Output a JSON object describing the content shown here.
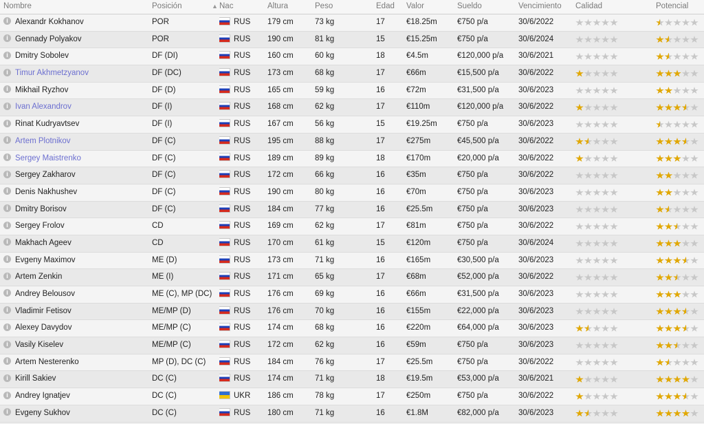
{
  "headers": {
    "nombre": "Nombre",
    "posicion": "Posición",
    "nac": "Nac",
    "altura": "Altura",
    "peso": "Peso",
    "edad": "Edad",
    "valor": "Valor",
    "sueldo": "Sueldo",
    "vencimiento": "Vencimiento",
    "calidad": "Calidad",
    "potencial": "Potencial"
  },
  "colors": {
    "link": "#6c6fd0",
    "star_filled": "#e2a800",
    "star_empty": "#c7c7c7"
  },
  "players": [
    {
      "name": "Alexandr Kokhanov",
      "link": false,
      "pos": "POR",
      "nat": "RUS",
      "alt": "179 cm",
      "peso": "73 kg",
      "edad": "17",
      "valor": "€18.25m",
      "sueldo": "€750 p/a",
      "venc": "30/6/2022",
      "cal": 0,
      "pot": 0.5
    },
    {
      "name": "Gennady Polyakov",
      "link": false,
      "pos": "POR",
      "nat": "RUS",
      "alt": "190 cm",
      "peso": "81 kg",
      "edad": "15",
      "valor": "€15.25m",
      "sueldo": "€750 p/a",
      "venc": "30/6/2024",
      "cal": 0,
      "pot": 1.5
    },
    {
      "name": "Dmitry Sobolev",
      "link": false,
      "pos": "DF (DI)",
      "nat": "RUS",
      "alt": "160 cm",
      "peso": "60 kg",
      "edad": "18",
      "valor": "€4.5m",
      "sueldo": "€120,000 p/a",
      "venc": "30/6/2021",
      "cal": 0,
      "pot": 1.5
    },
    {
      "name": "Timur Akhmetzyanov",
      "link": true,
      "pos": "DF (DC)",
      "nat": "RUS",
      "alt": "173 cm",
      "peso": "68 kg",
      "edad": "17",
      "valor": "€66m",
      "sueldo": "€15,500 p/a",
      "venc": "30/6/2022",
      "cal": 1,
      "pot": 3
    },
    {
      "name": "Mikhail Ryzhov",
      "link": false,
      "pos": "DF (D)",
      "nat": "RUS",
      "alt": "165 cm",
      "peso": "59 kg",
      "edad": "16",
      "valor": "€72m",
      "sueldo": "€31,500 p/a",
      "venc": "30/6/2023",
      "cal": 0,
      "pot": 2
    },
    {
      "name": "Ivan Alexandrov",
      "link": true,
      "pos": "DF (I)",
      "nat": "RUS",
      "alt": "168 cm",
      "peso": "62 kg",
      "edad": "17",
      "valor": "€110m",
      "sueldo": "€120,000 p/a",
      "venc": "30/6/2022",
      "cal": 1,
      "pot": 3.5
    },
    {
      "name": "Rinat Kudryavtsev",
      "link": false,
      "pos": "DF (I)",
      "nat": "RUS",
      "alt": "167 cm",
      "peso": "56 kg",
      "edad": "15",
      "valor": "€19.25m",
      "sueldo": "€750 p/a",
      "venc": "30/6/2023",
      "cal": 0,
      "pot": 0.5
    },
    {
      "name": "Artem Plotnikov",
      "link": true,
      "pos": "DF (C)",
      "nat": "RUS",
      "alt": "195 cm",
      "peso": "88 kg",
      "edad": "17",
      "valor": "€275m",
      "sueldo": "€45,500 p/a",
      "venc": "30/6/2022",
      "cal": 1.5,
      "pot": 3.5
    },
    {
      "name": "Sergey Maistrenko",
      "link": true,
      "pos": "DF (C)",
      "nat": "RUS",
      "alt": "189 cm",
      "peso": "89 kg",
      "edad": "18",
      "valor": "€170m",
      "sueldo": "€20,000 p/a",
      "venc": "30/6/2022",
      "cal": 1,
      "pot": 3
    },
    {
      "name": "Sergey Zakharov",
      "link": false,
      "pos": "DF (C)",
      "nat": "RUS",
      "alt": "172 cm",
      "peso": "66 kg",
      "edad": "16",
      "valor": "€35m",
      "sueldo": "€750 p/a",
      "venc": "30/6/2022",
      "cal": 0,
      "pot": 2
    },
    {
      "name": "Denis Nakhushev",
      "link": false,
      "pos": "DF (C)",
      "nat": "RUS",
      "alt": "190 cm",
      "peso": "80 kg",
      "edad": "16",
      "valor": "€70m",
      "sueldo": "€750 p/a",
      "venc": "30/6/2023",
      "cal": 0,
      "pot": 2
    },
    {
      "name": "Dmitry Borisov",
      "link": false,
      "pos": "DF (C)",
      "nat": "RUS",
      "alt": "184 cm",
      "peso": "77 kg",
      "edad": "16",
      "valor": "€25.5m",
      "sueldo": "€750 p/a",
      "venc": "30/6/2023",
      "cal": 0,
      "pot": 1.5
    },
    {
      "name": "Sergey Frolov",
      "link": false,
      "pos": "CD",
      "nat": "RUS",
      "alt": "169 cm",
      "peso": "62 kg",
      "edad": "17",
      "valor": "€81m",
      "sueldo": "€750 p/a",
      "venc": "30/6/2022",
      "cal": 0,
      "pot": 2.5
    },
    {
      "name": "Makhach Ageev",
      "link": false,
      "pos": "CD",
      "nat": "RUS",
      "alt": "170 cm",
      "peso": "61 kg",
      "edad": "15",
      "valor": "€120m",
      "sueldo": "€750 p/a",
      "venc": "30/6/2024",
      "cal": 0,
      "pot": 3
    },
    {
      "name": "Evgeny Maximov",
      "link": false,
      "pos": "ME (D)",
      "nat": "RUS",
      "alt": "173 cm",
      "peso": "71 kg",
      "edad": "16",
      "valor": "€165m",
      "sueldo": "€30,500 p/a",
      "venc": "30/6/2023",
      "cal": 0,
      "pot": 3.5
    },
    {
      "name": "Artem Zenkin",
      "link": false,
      "pos": "ME (I)",
      "nat": "RUS",
      "alt": "171 cm",
      "peso": "65 kg",
      "edad": "17",
      "valor": "€68m",
      "sueldo": "€52,000 p/a",
      "venc": "30/6/2022",
      "cal": 0,
      "pot": 2.5
    },
    {
      "name": "Andrey Belousov",
      "link": false,
      "pos": "ME (C), MP (DC)",
      "nat": "RUS",
      "alt": "176 cm",
      "peso": "69 kg",
      "edad": "16",
      "valor": "€66m",
      "sueldo": "€31,500 p/a",
      "venc": "30/6/2023",
      "cal": 0,
      "pot": 3
    },
    {
      "name": "Vladimir Fetisov",
      "link": false,
      "pos": "ME/MP (D)",
      "nat": "RUS",
      "alt": "176 cm",
      "peso": "70 kg",
      "edad": "16",
      "valor": "€155m",
      "sueldo": "€22,000 p/a",
      "venc": "30/6/2023",
      "cal": 0,
      "pot": 3.5
    },
    {
      "name": "Alexey Davydov",
      "link": false,
      "pos": "ME/MP (C)",
      "nat": "RUS",
      "alt": "174 cm",
      "peso": "68 kg",
      "edad": "16",
      "valor": "€220m",
      "sueldo": "€64,000 p/a",
      "venc": "30/6/2023",
      "cal": 1.5,
      "pot": 3.5
    },
    {
      "name": "Vasily Kiselev",
      "link": false,
      "pos": "ME/MP (C)",
      "nat": "RUS",
      "alt": "172 cm",
      "peso": "62 kg",
      "edad": "16",
      "valor": "€59m",
      "sueldo": "€750 p/a",
      "venc": "30/6/2023",
      "cal": 0,
      "pot": 2.5
    },
    {
      "name": "Artem Nesterenko",
      "link": false,
      "pos": "MP (D), DC (C)",
      "nat": "RUS",
      "alt": "184 cm",
      "peso": "76 kg",
      "edad": "17",
      "valor": "€25.5m",
      "sueldo": "€750 p/a",
      "venc": "30/6/2022",
      "cal": 0,
      "pot": 1.5
    },
    {
      "name": "Kirill Sakiev",
      "link": false,
      "pos": "DC (C)",
      "nat": "RUS",
      "alt": "174 cm",
      "peso": "71 kg",
      "edad": "18",
      "valor": "€19.5m",
      "sueldo": "€53,000 p/a",
      "venc": "30/6/2021",
      "cal": 1,
      "pot": 4
    },
    {
      "name": "Andrey Ignatjev",
      "link": false,
      "pos": "DC (C)",
      "nat": "UKR",
      "alt": "186 cm",
      "peso": "78 kg",
      "edad": "17",
      "valor": "€250m",
      "sueldo": "€750 p/a",
      "venc": "30/6/2022",
      "cal": 1,
      "pot": 3.5
    },
    {
      "name": "Evgeny Sukhov",
      "link": false,
      "pos": "DC (C)",
      "nat": "RUS",
      "alt": "180 cm",
      "peso": "71 kg",
      "edad": "16",
      "valor": "€1.8M",
      "sueldo": "€82,000 p/a",
      "venc": "30/6/2023",
      "cal": 1.5,
      "pot": 4
    }
  ]
}
